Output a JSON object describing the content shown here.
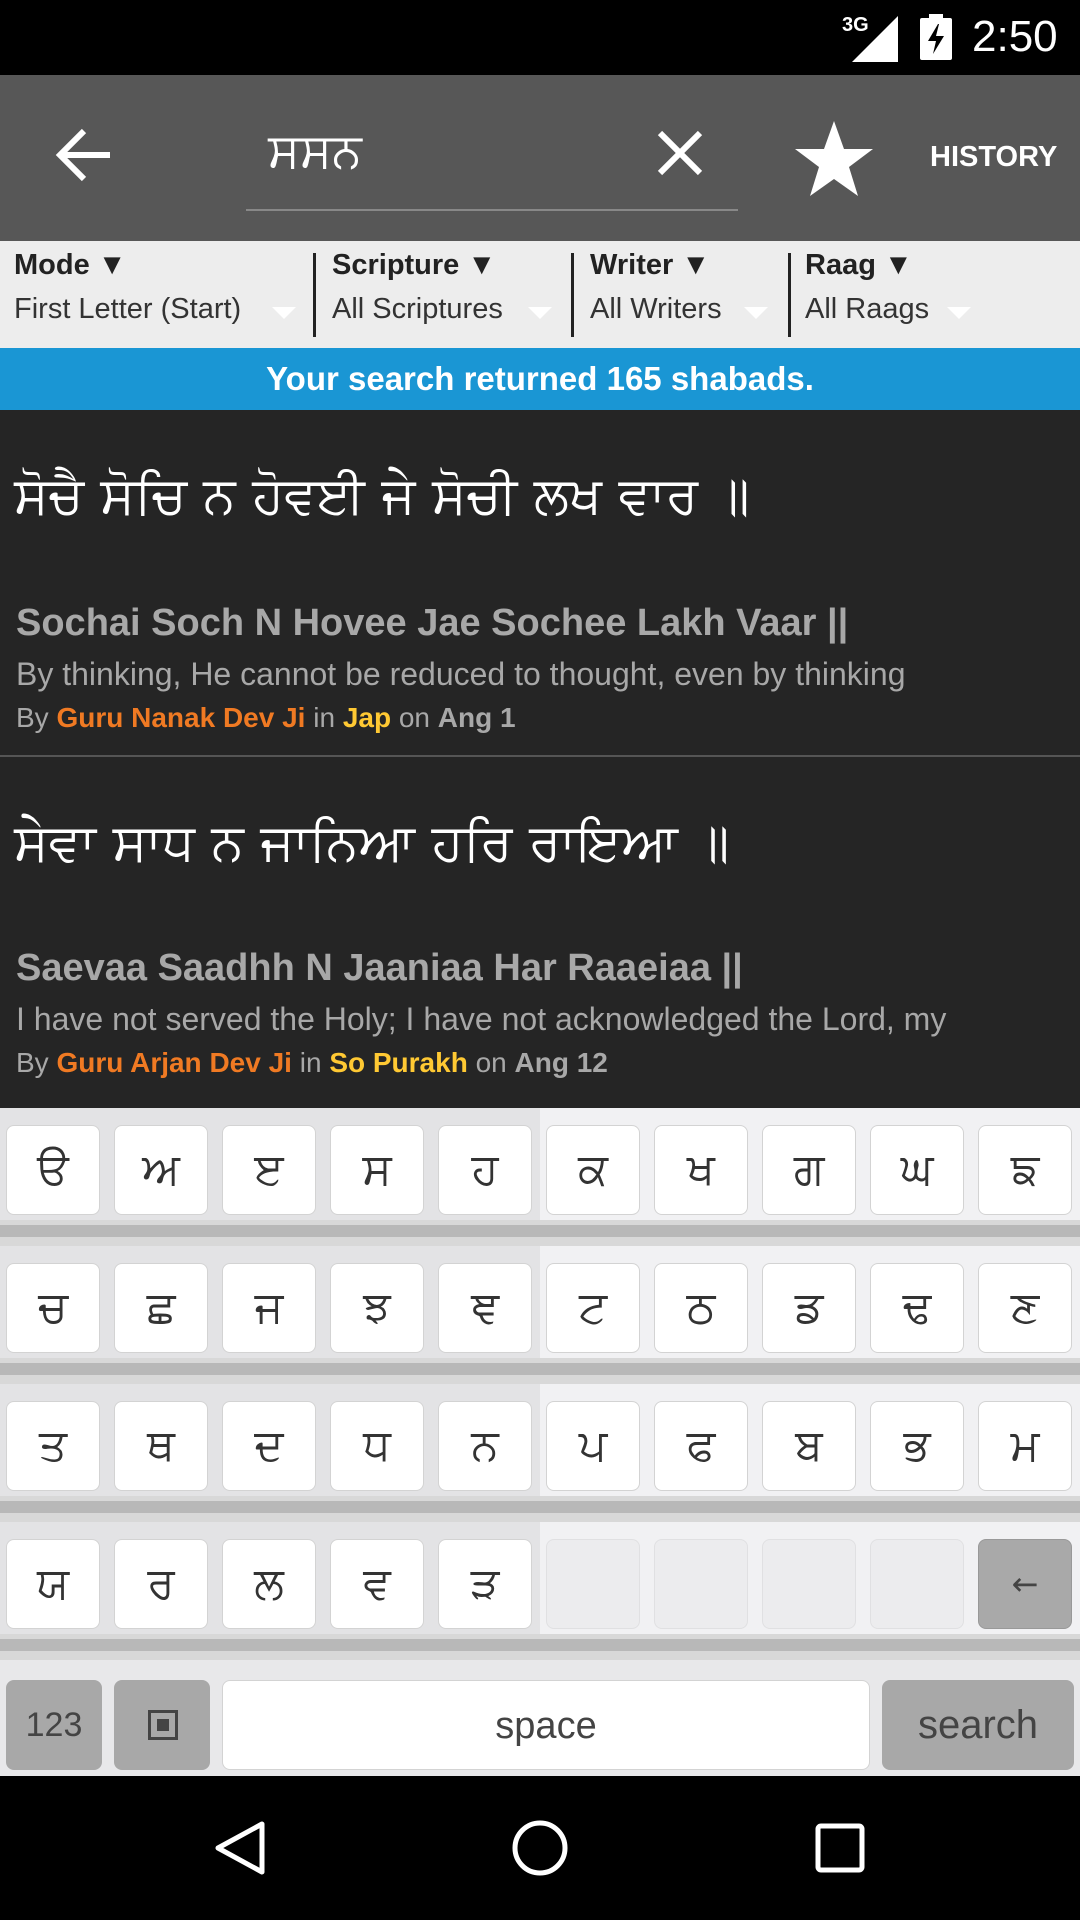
{
  "status_bar": {
    "network": "3G",
    "time": "2:50",
    "icons": [
      "signal-icon",
      "battery-charging-icon"
    ]
  },
  "action_bar": {
    "back_icon": "arrow-left-icon",
    "search_query": "ਸਸਨ",
    "clear_icon": "close-icon",
    "favorite_icon": "star-icon",
    "history_label": "HISTORY"
  },
  "filters": [
    {
      "title": "Mode ▼",
      "value": "First Letter (Start)"
    },
    {
      "title": "Scripture ▼",
      "value": "All Scriptures"
    },
    {
      "title": "Writer ▼",
      "value": "All Writers"
    },
    {
      "title": "Raag ▼",
      "value": "All Raags"
    }
  ],
  "banner": "Your search returned 165 shabads.",
  "results": [
    {
      "gurmukhi": "ਸੋਚੈ ਸੋਚਿ ਨ ਹੋਵਈ ਜੇ ਸੋਚੀ ਲਖ ਵਾਰ ॥",
      "transliteration": "Sochai Soch N Hovee Jae Sochee Lakh Vaar ||",
      "translation": "By thinking, He cannot be reduced to thought, even by thinking",
      "by": "By",
      "writer": "Guru Nanak Dev Ji",
      "in": "in",
      "source": "Jap",
      "on": "on",
      "ang": "Ang 1"
    },
    {
      "gurmukhi": "ਸੇਵਾ ਸਾਧ ਨ ਜਾਨਿਆ ਹਰਿ ਰਾਇਆ ॥",
      "transliteration": "Saevaa Saadhh N Jaaniaa Har Raaeiaa ||",
      "translation": "I have not served the Holy; I have not acknowledged the Lord, my",
      "by": "By",
      "writer": "Guru Arjan Dev Ji",
      "in": "in",
      "source": "So Purakh",
      "on": "on",
      "ang": "Ang 12"
    }
  ],
  "keyboard": {
    "rows": [
      [
        "ੳ",
        "ਅ",
        "ੲ",
        "ਸ",
        "ਹ",
        "ਕ",
        "ਖ",
        "ਗ",
        "ਘ",
        "ਙ"
      ],
      [
        "ਚ",
        "ਛ",
        "ਜ",
        "ਝ",
        "ਞ",
        "ਟ",
        "ਠ",
        "ਡ",
        "ਢ",
        "ਣ"
      ],
      [
        "ਤ",
        "ਥ",
        "ਦ",
        "ਧ",
        "ਨ",
        "ਪ",
        "ਫ",
        "ਬ",
        "ਭ",
        "ਮ"
      ],
      [
        "ਯ",
        "ਰ",
        "ਲ",
        "ਵ",
        "ੜ",
        "",
        "",
        "",
        "",
        "←"
      ]
    ],
    "key_123": "123",
    "space_label": "space",
    "search_label": "search"
  },
  "nav_bar": {
    "icons": [
      "back-triangle-icon",
      "home-circle-icon",
      "recents-square-icon"
    ]
  }
}
